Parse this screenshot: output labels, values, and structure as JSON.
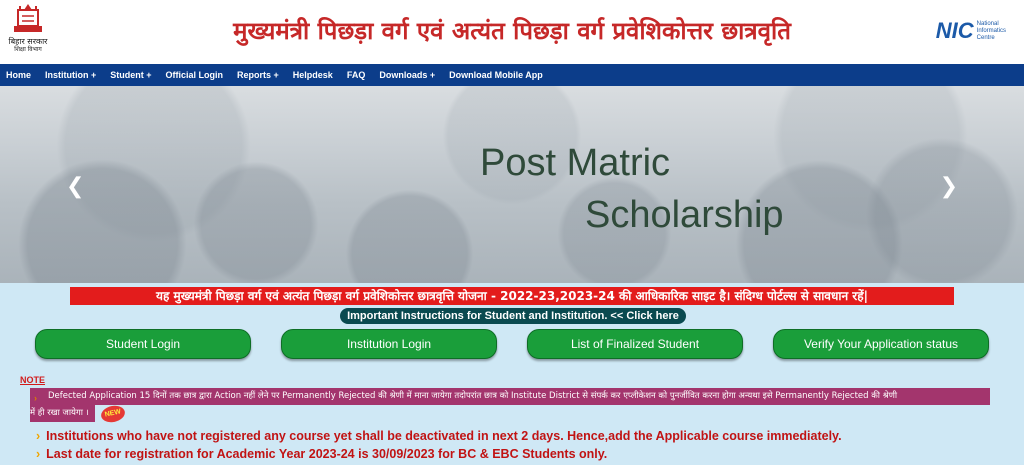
{
  "header": {
    "title": "मुख्यमंत्री पिछड़ा वर्ग एवं अत्यंत पिछड़ा वर्ग प्रवेशिकोत्तर छात्रवृति",
    "gov_label": "बिहार सरकार",
    "dept_label": "शिक्षा विभाग",
    "nic_mark": "NIC",
    "nic_line1": "National",
    "nic_line2": "Informatics",
    "nic_line3": "Centre"
  },
  "nav": {
    "items": [
      {
        "label": "Home"
      },
      {
        "label": "Institution +"
      },
      {
        "label": "Student +"
      },
      {
        "label": "Official Login"
      },
      {
        "label": "Reports +"
      },
      {
        "label": "Helpdesk"
      },
      {
        "label": "FAQ"
      },
      {
        "label": "Downloads +"
      },
      {
        "label": "Download Mobile App"
      }
    ]
  },
  "carousel": {
    "line1": "Post Matric",
    "line2": "Scholarship",
    "prev_icon": "chevron-left-icon",
    "next_icon": "chevron-right-icon"
  },
  "warning": "यह मुख्यमंत्री पिछड़ा वर्ग एवं अत्यंत पिछड़ा वर्ग प्रवेशिकोत्तर छात्रवृत्ति योजना - 2022-23,2023-24 की आधिकारिक साइट है। संदिग्ध पोर्टल्स से सावधान रहें|",
  "instructions_link": "Important Instructions for Student and Institution. << Click here",
  "buttons": {
    "student_login": "Student Login",
    "institution_login": "Institution Login",
    "finalized_list": "List of Finalized Student",
    "verify_status": "Verify Your Application status"
  },
  "note": {
    "label": "NOTE",
    "line1": "Defected Application 15 दिनों तक छात्र द्वारा Action नहीं लेने पर Permanently Rejected की श्रेणी में माना जायेगा तदोपरांत छात्र को Institute District से संपर्क कर एप्लीकेशन को पुनर्जीवित करना होगा अन्यथा इसे Permanently Rejected की श्रेणी",
    "line2": "में ही रखा जायेगा ।",
    "new_badge": "NEW"
  },
  "bullets": [
    "Institutions who have not registered any course yet shall be deactivated in next 2 days. Hence,add the Applicable course immediately.",
    "Last date for registration for Academic Year 2023-24 is 30/09/2023 for BC & EBC Students only."
  ],
  "colors": {
    "title_red": "#c62828",
    "nav_blue": "#0c3d8a",
    "button_green": "#1a9e3a",
    "warning_red": "#e31c1c",
    "notice_purple": "#a3356d",
    "info_bg": "#cfe8f5"
  }
}
